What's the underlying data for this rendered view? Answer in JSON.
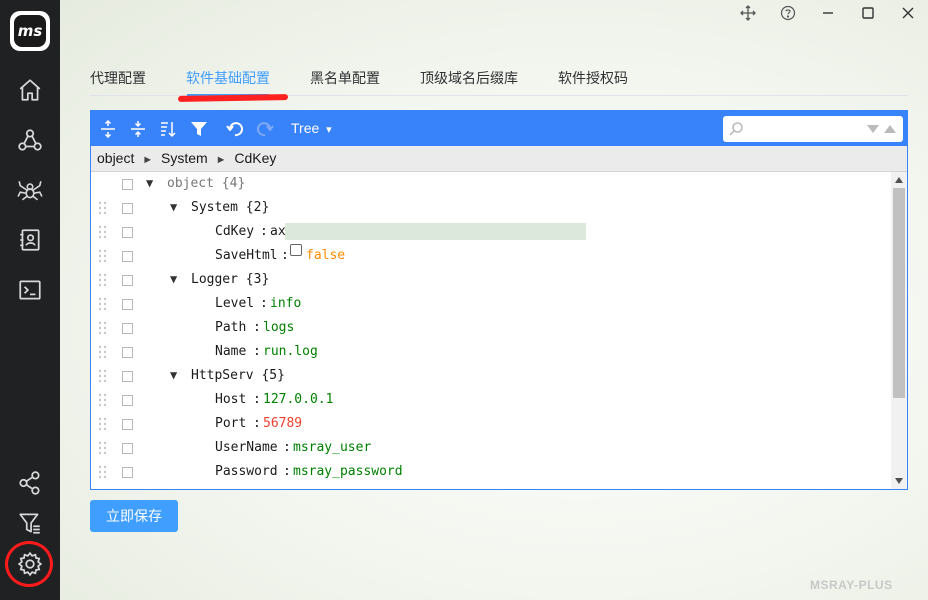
{
  "app": {
    "logo_text": "ms",
    "watermark": "MSRAY-PLUS"
  },
  "colors": {
    "accent": "#409eff",
    "editor_blue": "#3883fa",
    "sidebar_bg": "#1f2122",
    "string_value": "#008000",
    "number_value": "#ee422e",
    "boolean_value": "#ff8c00",
    "annotation_red": "#ff1b1b"
  },
  "sidebar": {
    "items": [
      {
        "icon": "home-icon"
      },
      {
        "icon": "network-icon"
      },
      {
        "icon": "spider-icon"
      },
      {
        "icon": "contacts-icon"
      },
      {
        "icon": "terminal-icon"
      },
      {
        "icon": "share-nodes-icon"
      },
      {
        "icon": "filter-list-icon"
      },
      {
        "icon": "gear-icon"
      }
    ]
  },
  "window_controls": [
    "move-icon",
    "help-icon",
    "minimize-icon",
    "maximize-icon",
    "close-icon"
  ],
  "tabs": [
    {
      "label": "代理配置",
      "active": false
    },
    {
      "label": "软件基础配置",
      "active": true
    },
    {
      "label": "黑名单配置",
      "active": false
    },
    {
      "label": "顶级域名后缀库",
      "active": false
    },
    {
      "label": "软件授权码",
      "active": false
    }
  ],
  "editor": {
    "mode": "Tree",
    "mode_caret": "▾",
    "search_placeholder": "",
    "breadcrumb": [
      "object",
      "System",
      "CdKey"
    ],
    "breadcrumb_sep": "►",
    "tree": {
      "root_label": "object",
      "root_count": "{4}",
      "system": {
        "label": "System",
        "count": "{2}",
        "cdkey_key": "CdKey",
        "cdkey_value": "ax",
        "savehtml_key": "SaveHtml",
        "savehtml_value": "false"
      },
      "logger": {
        "label": "Logger",
        "count": "{3}",
        "level_key": "Level",
        "level_value": "info",
        "path_key": "Path",
        "path_value": "logs",
        "name_key": "Name",
        "name_value": "run.log"
      },
      "httpserv": {
        "label": "HttpServ",
        "count": "{5}",
        "host_key": "Host",
        "host_value": "127.0.0.1",
        "port_key": "Port",
        "port_value": "56789",
        "username_key": "UserName",
        "username_value": "msray_user",
        "password_key": "Password",
        "password_value": "msray_password"
      },
      "colon": ":",
      "expand_glyph": "▼"
    }
  },
  "save_button": "立即保存"
}
